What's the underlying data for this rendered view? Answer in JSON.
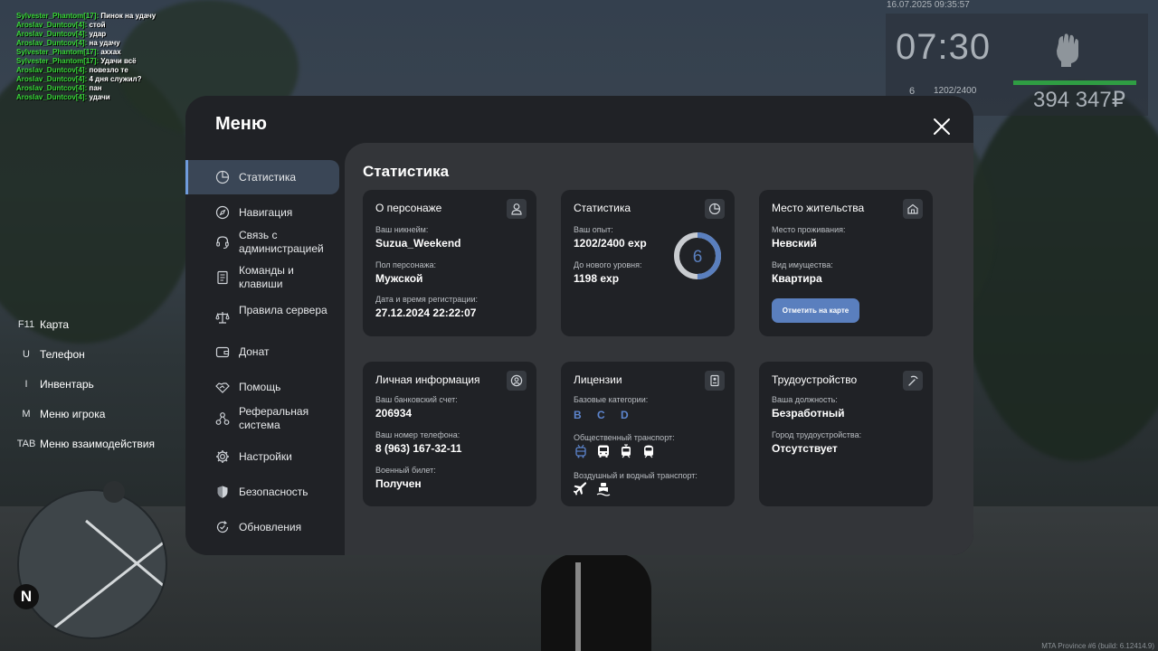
{
  "chat": [
    {
      "name": "Sylvester_Phantom[17]:",
      "text": "Пинок на удачу"
    },
    {
      "name": "Aroslav_Duntcov[4]:",
      "text": "стой"
    },
    {
      "name": "Aroslav_Duntcov[4]:",
      "text": "удар"
    },
    {
      "name": "Aroslav_Duntcov[4]:",
      "text": "на удачу"
    },
    {
      "name": "Sylvester_Phantom[17]:",
      "text": "аххах"
    },
    {
      "name": "Sylvester_Phantom[17]:",
      "text": "Удачи всё"
    },
    {
      "name": "Aroslav_Duntcov[4]:",
      "text": "повезло те"
    },
    {
      "name": "Aroslav_Duntcov[4]:",
      "text": "4 дня служил?"
    },
    {
      "name": "Aroslav_Duntcov[4]:",
      "text": "пан"
    },
    {
      "name": "Aroslav_Duntcov[4]:",
      "text": "удачи"
    }
  ],
  "hud": {
    "datetime": "16.07.2025 09:35:57",
    "time": "07:30",
    "level": "6",
    "exp": "1202/2400",
    "money": "394 347₽"
  },
  "keybinds": [
    {
      "key": "F11",
      "action": "Карта"
    },
    {
      "key": "U",
      "action": "Телефон"
    },
    {
      "key": "I",
      "action": "Инвентарь"
    },
    {
      "key": "M",
      "action": "Меню игрока"
    },
    {
      "key": "TAB",
      "action": "Меню взаимодействия"
    }
  ],
  "minimap": {
    "north": "N"
  },
  "build": "MTA Province #6 (build: 6.12414.9)",
  "menu": {
    "title": "Меню",
    "nav": [
      {
        "label": "Статистика",
        "icon": "pie-chart-icon",
        "active": true
      },
      {
        "label": "Навигация",
        "icon": "compass-icon"
      },
      {
        "label": "Связь с администрацией",
        "icon": "headset-icon"
      },
      {
        "label": "Команды и клавиши",
        "icon": "document-icon"
      },
      {
        "label": "Правила сервера",
        "icon": "scales-icon"
      },
      {
        "label": "Донат",
        "icon": "wallet-icon"
      },
      {
        "label": "Помощь",
        "icon": "handshake-icon"
      },
      {
        "label": "Реферальная система",
        "icon": "referral-icon"
      },
      {
        "label": "Настройки",
        "icon": "gear-icon"
      },
      {
        "label": "Безопасность",
        "icon": "shield-icon"
      },
      {
        "label": "Обновления",
        "icon": "update-icon"
      }
    ]
  },
  "content": {
    "title": "Статистика",
    "character": {
      "title": "О персонаже",
      "nickname_label": "Ваш никнейм:",
      "nickname": "Suzua_Weekend",
      "gender_label": "Пол персонажа:",
      "gender": "Мужской",
      "reg_label": "Дата и время регистрации:",
      "reg": "27.12.2024 22:22:07"
    },
    "stats": {
      "title": "Статистика",
      "exp_label": "Ваш опыт:",
      "exp": "1202/2400 exp",
      "next_label": "До нового уровня:",
      "next": "1198 exp",
      "level": "6",
      "progress": 0.5
    },
    "residence": {
      "title": "Место жительства",
      "place_label": "Место проживания:",
      "place": "Невский",
      "type_label": "Вид имущества:",
      "type": "Квартира",
      "button": "Отметить на карте"
    },
    "personal": {
      "title": "Личная информация",
      "bank_label": "Ваш банковский счет:",
      "bank": "206934",
      "phone_label": "Ваш номер телефона:",
      "phone": "8 (963) 167-32-11",
      "military_label": "Военный билет:",
      "military": "Получен"
    },
    "licenses": {
      "title": "Лицензии",
      "base_label": "Базовые категории:",
      "base": "B C D",
      "public_label": "Общественный транспорт:",
      "public_icons": [
        "trolleybus-icon",
        "bus-icon",
        "tram-icon",
        "metro-icon"
      ],
      "air_label": "Воздушный и водный транспорт:",
      "air_icons": [
        "airplane-icon",
        "boat-icon"
      ]
    },
    "job": {
      "title": "Трудоустройство",
      "position_label": "Ваша должность:",
      "position": "Безработный",
      "city_label": "Город трудоустройства:",
      "city": "Отсутствует"
    }
  },
  "colors": {
    "accent": "#5a7fbe",
    "nav_active": "#3a4656",
    "chat_name": "#38d838"
  }
}
